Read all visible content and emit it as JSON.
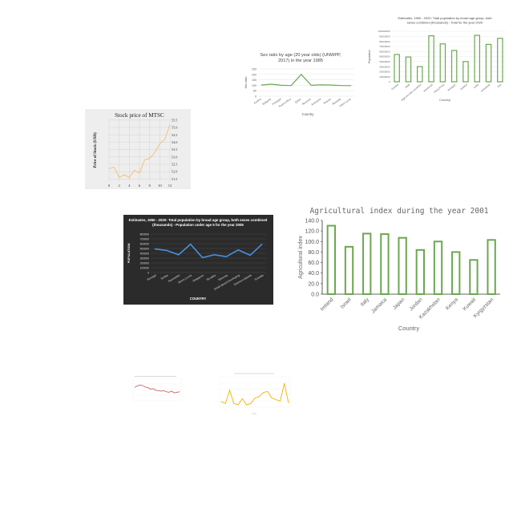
{
  "colors": {
    "green": "#6aa84f",
    "stock_line": "#f2c068",
    "dark_line": "#4a90d9",
    "red_line": "#c0504d",
    "yellow_line": "#f0b400",
    "dark_bg": "#2b2b2b",
    "grid": "#dddddd"
  },
  "chart_data": [
    {
      "id": "sex_ratio",
      "type": "line",
      "title": "Sex ratio by age (20 year olds) (UNWPP, 2017) in the year 1985",
      "xlabel": "Country",
      "ylabel": "Sex ratio",
      "categories": [
        "Austria",
        "Bulgaria",
        "Portugal",
        "Puerto Rico",
        "Qatar",
        "Reunion",
        "Romania",
        "Russia",
        "Rwanda",
        "Saint Lucia"
      ],
      "values": [
        102,
        110,
        100,
        98,
        200,
        100,
        104,
        102,
        98,
        97
      ],
      "yticks": [
        0,
        50,
        100,
        150,
        200,
        250
      ],
      "ylim": [
        0,
        250
      ],
      "grid": true
    },
    {
      "id": "total_population",
      "type": "bar",
      "title": "Estimates, 1950 - 2020: Total population by broad age group, both sexes combined (thousands) - Total for the year 2020",
      "xlabel": "Country",
      "ylabel": "Population",
      "categories": [
        "Guinea",
        "Haiti",
        "High-income countries",
        "Honduras",
        "Hong Kong",
        "Hungary",
        "Iceland",
        "India",
        "Indonesia",
        "Iran"
      ],
      "values": [
        54000000,
        49000000,
        30000000,
        91000000,
        75000000,
        62000000,
        40000000,
        92000000,
        74000000,
        86000000
      ],
      "yticks": [
        0,
        10000000,
        20000000,
        30000000,
        40000000,
        50000000,
        60000000,
        70000000,
        80000000,
        90000000,
        100000000
      ],
      "ytick_labels": [
        "0",
        "10000000",
        "20000000",
        "30000000",
        "40000000",
        "50000000",
        "60000000",
        "70000000",
        "80000000",
        "90000000",
        "100000000"
      ],
      "ylim": [
        0,
        100000000
      ],
      "grid": true
    },
    {
      "id": "stock_price",
      "type": "line",
      "title": "Stock price of MTSC",
      "xlabel": "",
      "ylabel": "Price of Stock (USD)",
      "x": [
        0,
        1,
        2,
        3,
        4,
        5,
        6,
        7,
        8,
        9,
        10,
        11,
        12
      ],
      "values": [
        52.2,
        52.3,
        51.6,
        51.8,
        51.6,
        52.1,
        51.9,
        52.8,
        52.9,
        53.3,
        53.9,
        54.2,
        55.2
      ],
      "xticks": [
        0,
        2,
        4,
        6,
        8,
        10,
        12
      ],
      "yticks": [
        51.5,
        52.0,
        52.5,
        53.0,
        53.5,
        54.0,
        54.5,
        55.0,
        55.5
      ],
      "ytick_labels": [
        "51.5",
        "52.0",
        "52.5",
        "53.0",
        "53.5",
        "54.0",
        "54.5",
        "55.0",
        "55.5"
      ],
      "xlim": [
        0,
        12
      ],
      "ylim": [
        51.3,
        55.6
      ],
      "grid": true
    },
    {
      "id": "under_age_5",
      "type": "line",
      "title": "Estimates, 1950 - 2020: Total population by broad age group, both sexes combined (thousands) - Population under age 5 for the year 2005",
      "xlabel": "COUNTRY",
      "ylabel": "POPULATION",
      "categories": [
        "Senegal",
        "Serbia",
        "Seychelles",
        "Sierra Leone",
        "Singapore",
        "Slovakia",
        "Slovenia",
        "Small Island Developing",
        "Solomon Islands",
        "Somalia"
      ],
      "values": [
        490000,
        460000,
        370000,
        590000,
        310000,
        370000,
        330000,
        470000,
        360000,
        590000
      ],
      "yticks": [
        0,
        100000,
        200000,
        300000,
        400000,
        500000,
        600000,
        700000,
        800000
      ],
      "ytick_labels": [
        "0",
        "100000",
        "200000",
        "300000",
        "400000",
        "500000",
        "600000",
        "700000",
        "800000"
      ],
      "ylim": [
        0,
        800000
      ],
      "grid": true
    },
    {
      "id": "agricultural_index",
      "type": "bar",
      "title": "Agricultural index during the year 2001",
      "xlabel": "Country",
      "ylabel": "Agricultural index",
      "categories": [
        "Ireland",
        "Israel",
        "Italy",
        "Jamaica",
        "Japan",
        "Jordan",
        "Kazakhstan",
        "Kenya",
        "Kuwait",
        "Kyrgyzstan"
      ],
      "values": [
        130,
        90,
        115,
        114,
        107,
        84,
        100,
        80,
        65,
        103
      ],
      "yticks": [
        0,
        20,
        40,
        60,
        80,
        100,
        120,
        140
      ],
      "ytick_labels": [
        "0.0",
        "20.0",
        "40.0",
        "60.0",
        "80.0",
        "100.0",
        "120.0",
        "140.0"
      ],
      "ylim": [
        0,
        140
      ],
      "grid": false
    },
    {
      "id": "small_red",
      "type": "line",
      "values": [
        60,
        66,
        70,
        68,
        61,
        59,
        52,
        54,
        47,
        45,
        43,
        45,
        40,
        38,
        43,
        35,
        38,
        40
      ],
      "ylim": [
        0,
        100
      ],
      "grid": true
    },
    {
      "id": "small_yellow",
      "type": "line",
      "values": [
        18,
        12,
        56,
        12,
        8,
        28,
        8,
        12,
        30,
        35,
        48,
        52,
        30,
        25,
        20,
        78,
        14
      ],
      "ylim": [
        0,
        100
      ],
      "grid": true
    }
  ]
}
